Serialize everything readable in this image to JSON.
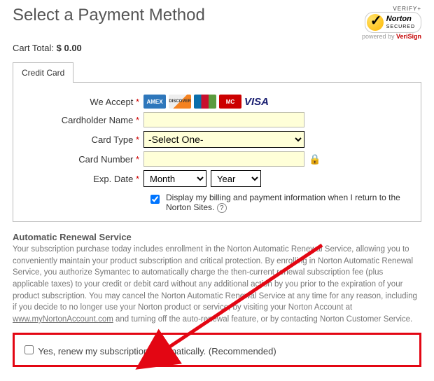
{
  "header": {
    "title": "Select a Payment Method",
    "verify_text": "VERIFY+",
    "powered_by": "powered by",
    "verisign": "VeriSign",
    "seal_brand": "Norton",
    "seal_sub": "SECURED"
  },
  "cart": {
    "label": "Cart Total:",
    "amount": "$ 0.00"
  },
  "tab": {
    "credit_card": "Credit Card"
  },
  "form": {
    "we_accept": "We Accept",
    "cardholder": "Cardholder Name",
    "card_type": "Card Type",
    "card_type_placeholder": "-Select One-",
    "card_number": "Card Number",
    "exp_date": "Exp. Date",
    "month_placeholder": "Month",
    "year_placeholder": "Year",
    "display_info": "Display my billing and payment information when I return to the Norton Sites.",
    "req_mark": "*",
    "cards": [
      "AMEX",
      "DISCOVER",
      "JCB",
      "MasterCard",
      "VISA"
    ]
  },
  "auto_renewal": {
    "heading": "Automatic Renewal Service",
    "body_1": "Your subscription purchase today includes enrollment in the Norton Automatic Renewal Service, allowing you to conveniently maintain your product subscription and critical protection. By enrolling in Norton Automatic Renewal Service, you authorize Symantec to automatically charge the then-current renewal subscription fee (plus applicable taxes) to your credit or debit card without any additional action by you prior to the expiration of your product subscription. You may cancel the Norton Automatic Renewal Service at any time for any reason, including if you decide to no longer use your Norton product or service, by visiting your Norton Account at ",
    "link": "www.myNortonAccount.com",
    "body_2": " and turning off the auto-renewal feature, or by contacting Norton Customer Service.",
    "checkbox_label": "Yes, renew my subscription automatically. (Recommended)"
  }
}
